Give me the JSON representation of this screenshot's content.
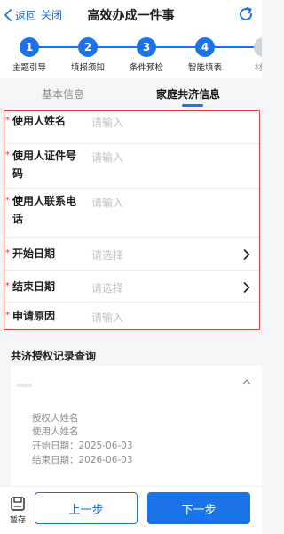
{
  "header": {
    "back_label": "返回",
    "close_label": "关闭",
    "title": "高效办成一件事"
  },
  "steps": [
    {
      "number": "1",
      "label": "主题引导",
      "state": "done"
    },
    {
      "number": "2",
      "label": "填报须知",
      "state": "done"
    },
    {
      "number": "3",
      "label": "条件预检",
      "state": "done"
    },
    {
      "number": "4",
      "label": "智能填表",
      "state": "current"
    },
    {
      "number": "",
      "label": "材料",
      "state": "pending"
    }
  ],
  "tabs": {
    "basic": "基本信息",
    "family": "家庭共济信息",
    "active": "family"
  },
  "form": {
    "fields": [
      {
        "label": "使用人姓名",
        "placeholder": "请输入",
        "required": true,
        "type": "input"
      },
      {
        "label_line1": "使用人证件号",
        "label_line2": "码",
        "placeholder": "请输入",
        "required": true,
        "type": "input"
      },
      {
        "label_line1": "使用人联系电",
        "label_line2": "话",
        "placeholder": "请输入",
        "required": true,
        "type": "input"
      },
      {
        "label": "开始日期",
        "placeholder": "请选择",
        "required": true,
        "type": "select"
      },
      {
        "label": "结束日期",
        "placeholder": "请选择",
        "required": true,
        "type": "select"
      },
      {
        "label": "申请原因",
        "placeholder": "请输入",
        "required": true,
        "type": "input"
      }
    ],
    "required_mark": "*"
  },
  "record_section": {
    "title": "共济授权记录查询",
    "lines": [
      "授权人姓名",
      "使用人姓名",
      "开始日期：2025-06-03",
      "结束日期：2026-06-03"
    ]
  },
  "bottom_bar": {
    "save_label": "暂存",
    "prev_label": "上一步",
    "next_label": "下一步"
  },
  "colors": {
    "accent": "#1a73e8",
    "required": "#e03a3a",
    "error_border": "#e04646"
  },
  "icons": [
    "chevron-left-icon",
    "refresh-icon",
    "chevron-right-icon",
    "chevron-up-icon",
    "save-icon"
  ]
}
